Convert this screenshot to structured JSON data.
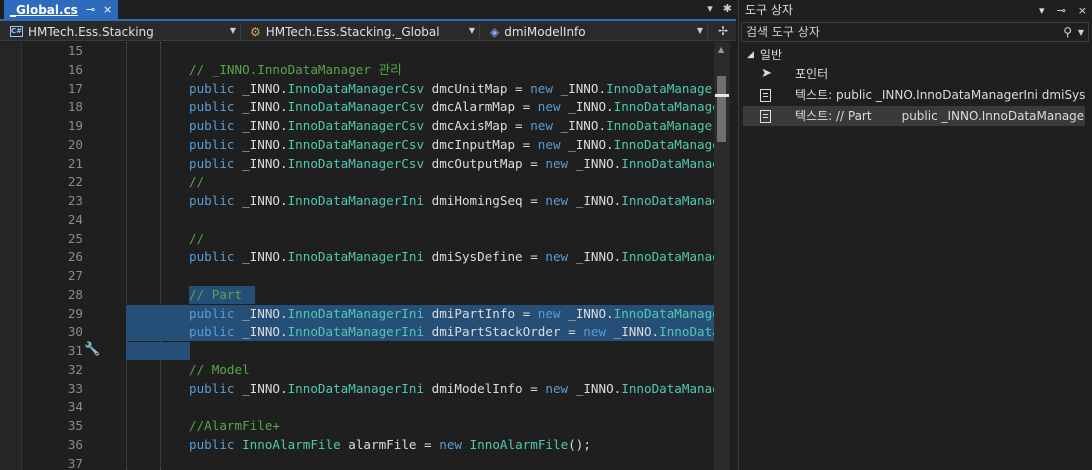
{
  "editor": {
    "tab": {
      "title": "_Global.cs",
      "pin_icon": "⊸",
      "close_icon": "×"
    },
    "tabbar_buttons": [
      "▾",
      "✱"
    ],
    "nav": {
      "project": "HMTech.Ess.Stacking",
      "class": "HMTech.Ess.Stacking._Global",
      "member": "dmiModelInfo",
      "split_icon": "✢"
    },
    "lines": [
      {
        "num": "15",
        "segments": []
      },
      {
        "num": "16",
        "segments": [
          {
            "c": "cm",
            "t": "// _INNO.InnoDataManager 관리"
          }
        ]
      },
      {
        "num": "17",
        "segments": [
          {
            "c": "kw",
            "t": "public "
          },
          {
            "c": "pl",
            "t": "_INNO."
          },
          {
            "c": "ty",
            "t": "InnoDataManagerCsv"
          },
          {
            "c": "pl",
            "t": " dmcUnitMap = "
          },
          {
            "c": "kw",
            "t": "new "
          },
          {
            "c": "pl",
            "t": "_INNO."
          },
          {
            "c": "ty",
            "t": "InnoDataManagerCsv"
          }
        ]
      },
      {
        "num": "18",
        "segments": [
          {
            "c": "kw",
            "t": "public "
          },
          {
            "c": "pl",
            "t": "_INNO."
          },
          {
            "c": "ty",
            "t": "InnoDataManagerCsv"
          },
          {
            "c": "pl",
            "t": " dmcAlarmMap = "
          },
          {
            "c": "kw",
            "t": "new "
          },
          {
            "c": "pl",
            "t": "_INNO."
          },
          {
            "c": "ty",
            "t": "InnoDataManagerCsv"
          }
        ]
      },
      {
        "num": "19",
        "segments": [
          {
            "c": "kw",
            "t": "public "
          },
          {
            "c": "pl",
            "t": "_INNO."
          },
          {
            "c": "ty",
            "t": "InnoDataManagerCsv"
          },
          {
            "c": "pl",
            "t": " dmcAxisMap = "
          },
          {
            "c": "kw",
            "t": "new "
          },
          {
            "c": "pl",
            "t": "_INNO."
          },
          {
            "c": "ty",
            "t": "InnoDataManagerCsv"
          }
        ]
      },
      {
        "num": "20",
        "segments": [
          {
            "c": "kw",
            "t": "public "
          },
          {
            "c": "pl",
            "t": "_INNO."
          },
          {
            "c": "ty",
            "t": "InnoDataManagerCsv"
          },
          {
            "c": "pl",
            "t": " dmcInputMap = "
          },
          {
            "c": "kw",
            "t": "new "
          },
          {
            "c": "pl",
            "t": "_INNO."
          },
          {
            "c": "ty",
            "t": "InnoDataManagerCsv"
          }
        ]
      },
      {
        "num": "21",
        "segments": [
          {
            "c": "kw",
            "t": "public "
          },
          {
            "c": "pl",
            "t": "_INNO."
          },
          {
            "c": "ty",
            "t": "InnoDataManagerCsv"
          },
          {
            "c": "pl",
            "t": " dmcOutputMap = "
          },
          {
            "c": "kw",
            "t": "new "
          },
          {
            "c": "pl",
            "t": "_INNO."
          },
          {
            "c": "ty",
            "t": "InnoDataManagerCsv"
          }
        ]
      },
      {
        "num": "22",
        "segments": [
          {
            "c": "cm",
            "t": "//"
          }
        ]
      },
      {
        "num": "23",
        "segments": [
          {
            "c": "kw",
            "t": "public "
          },
          {
            "c": "pl",
            "t": "_INNO."
          },
          {
            "c": "ty",
            "t": "InnoDataManagerIni"
          },
          {
            "c": "pl",
            "t": " dmiHomingSeq = "
          },
          {
            "c": "kw",
            "t": "new "
          },
          {
            "c": "pl",
            "t": "_INNO."
          },
          {
            "c": "ty",
            "t": "InnoDataManagerIni"
          }
        ]
      },
      {
        "num": "24",
        "segments": []
      },
      {
        "num": "25",
        "segments": [
          {
            "c": "cm",
            "t": "//"
          }
        ]
      },
      {
        "num": "26",
        "segments": [
          {
            "c": "kw",
            "t": "public "
          },
          {
            "c": "pl",
            "t": "_INNO."
          },
          {
            "c": "ty",
            "t": "InnoDataManagerIni"
          },
          {
            "c": "pl",
            "t": " dmiSysDefine = "
          },
          {
            "c": "kw",
            "t": "new "
          },
          {
            "c": "pl",
            "t": "_INNO."
          },
          {
            "c": "ty",
            "t": "InnoDataManagerIni"
          }
        ]
      },
      {
        "num": "27",
        "segments": []
      },
      {
        "num": "28",
        "segments": [
          {
            "c": "cm",
            "t": "// Part "
          }
        ]
      },
      {
        "num": "29",
        "segments": [
          {
            "c": "kw",
            "t": "public "
          },
          {
            "c": "pl",
            "t": "_INNO."
          },
          {
            "c": "ty",
            "t": "InnoDataManagerIni"
          },
          {
            "c": "pl",
            "t": " dmiPartInfo = "
          },
          {
            "c": "kw",
            "t": "new "
          },
          {
            "c": "pl",
            "t": "_INNO."
          },
          {
            "c": "ty",
            "t": "InnoDataManagerIni"
          }
        ]
      },
      {
        "num": "30",
        "segments": [
          {
            "c": "kw",
            "t": "public "
          },
          {
            "c": "pl",
            "t": "_INNO."
          },
          {
            "c": "ty",
            "t": "InnoDataManagerIni"
          },
          {
            "c": "pl",
            "t": " dmiPartStackOrder = "
          },
          {
            "c": "kw",
            "t": "new "
          },
          {
            "c": "pl",
            "t": "_INNO."
          },
          {
            "c": "ty",
            "t": "InnoDataManagerIni"
          }
        ]
      },
      {
        "num": "31",
        "segments": []
      },
      {
        "num": "32",
        "segments": [
          {
            "c": "cm",
            "t": "// Model"
          }
        ]
      },
      {
        "num": "33",
        "segments": [
          {
            "c": "kw",
            "t": "public "
          },
          {
            "c": "pl",
            "t": "_INNO."
          },
          {
            "c": "ty",
            "t": "InnoDataManagerIni"
          },
          {
            "c": "pl",
            "t": " dmiModelInfo = "
          },
          {
            "c": "kw",
            "t": "new "
          },
          {
            "c": "pl",
            "t": "_INNO."
          },
          {
            "c": "ty",
            "t": "InnoDataManagerIni"
          }
        ]
      },
      {
        "num": "34",
        "segments": []
      },
      {
        "num": "35",
        "segments": [
          {
            "c": "cm",
            "t": "//AlarmFile+"
          }
        ]
      },
      {
        "num": "36",
        "segments": [
          {
            "c": "kw",
            "t": "public "
          },
          {
            "c": "ty",
            "t": "InnoAlarmFile"
          },
          {
            "c": "pl",
            "t": " alarmFile = "
          },
          {
            "c": "kw",
            "t": "new "
          },
          {
            "c": "ty",
            "t": "InnoAlarmFile"
          },
          {
            "c": "pl",
            "t": "();"
          }
        ]
      },
      {
        "num": "37",
        "segments": []
      }
    ]
  },
  "toolbox": {
    "title": "도구 상자",
    "title_buttons": [
      "▾",
      "⊸",
      "×"
    ],
    "search_placeholder": "검색 도구 상자",
    "group": "일반",
    "items": [
      {
        "label": "포인터",
        "icon": "pointer-icon"
      },
      {
        "label": "텍스트: public _INNO.InnoDataManagerIni dmiSysD...",
        "icon": "text-snippet-icon"
      },
      {
        "label_a": "텍스트: // Part",
        "label_b": "public _INNO.InnoDataManager...",
        "icon": "text-snippet-icon"
      }
    ]
  }
}
